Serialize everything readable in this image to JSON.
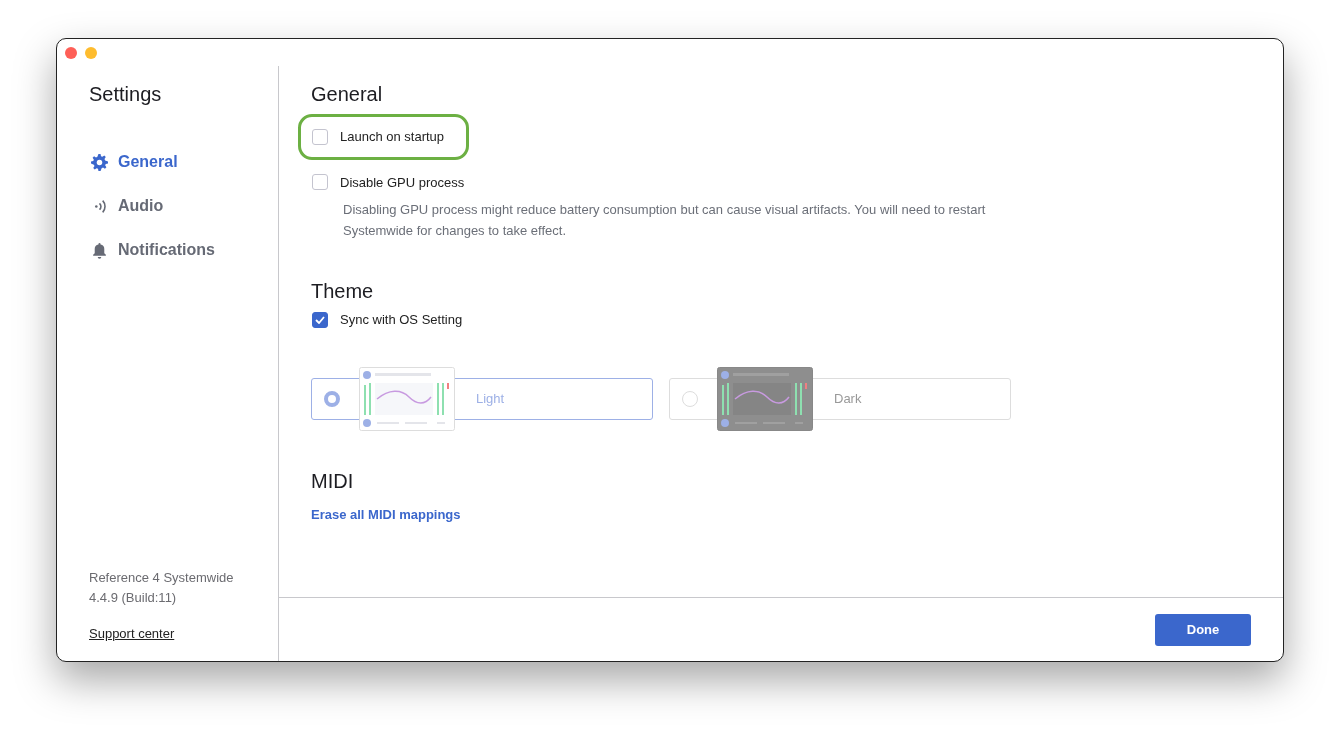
{
  "window": {
    "controls": [
      {
        "kind": "close"
      },
      {
        "kind": "minimize"
      }
    ]
  },
  "sidebar": {
    "title": "Settings",
    "items": [
      {
        "label": "General",
        "kind": "gear",
        "selected": true
      },
      {
        "label": "Audio",
        "kind": "signal",
        "selected": false
      },
      {
        "label": "Notifications",
        "kind": "bell",
        "selected": false
      }
    ],
    "app_name": "Reference 4 Systemwide",
    "version": "4.4.9 (Build:11)",
    "support_link": "Support center"
  },
  "general": {
    "heading": "General",
    "options": [
      {
        "label": "Launch on startup",
        "checked": false,
        "highlighted": true
      },
      {
        "label": "Disable GPU process",
        "checked": false,
        "highlighted": false,
        "description": "Disabling GPU process might reduce battery consumption but can cause visual artifacts. You will need to restart Systemwide for changes to take effect."
      }
    ]
  },
  "theme": {
    "heading": "Theme",
    "sync": {
      "label": "Sync with OS Setting",
      "checked": true
    },
    "options": [
      {
        "label": "Light",
        "kind": "light",
        "selected": true
      },
      {
        "label": "Dark",
        "kind": "dark",
        "selected": false
      }
    ]
  },
  "midi": {
    "heading": "MIDI",
    "link": "Erase all MIDI mappings"
  },
  "footer": {
    "button": "Done"
  }
}
